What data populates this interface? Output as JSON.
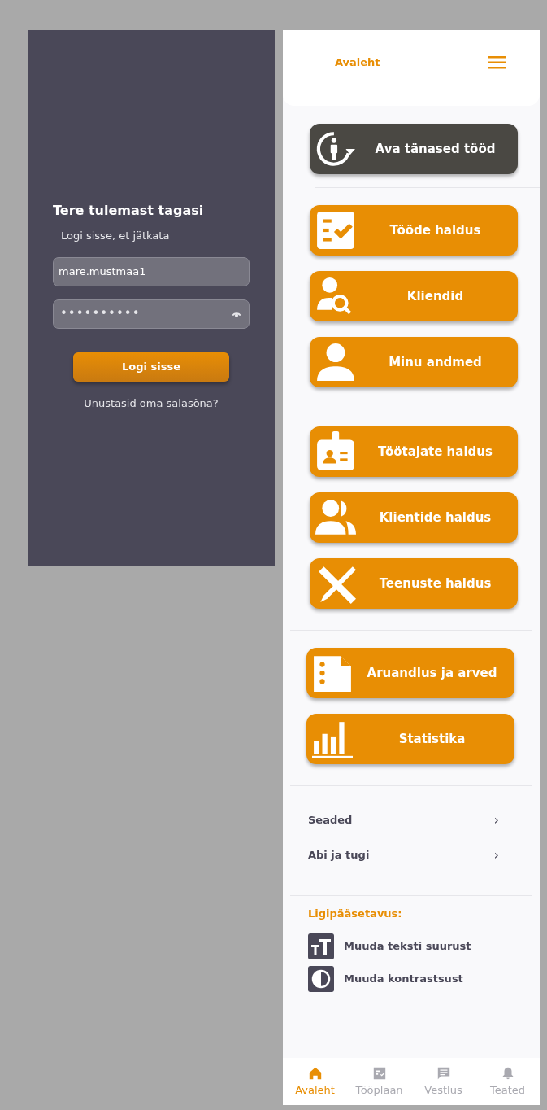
{
  "login": {
    "title": "Tere tulemast tagasi",
    "subtitle": "Logi sisse, et jätkata",
    "username": {
      "value": "mare.mustmaa1"
    },
    "password": {
      "value": "••••••••••"
    },
    "submit": "Logi sisse",
    "forgot": "Unustasid oma salasõna?"
  },
  "header": {
    "title": "Avaleht"
  },
  "menu_groups": [
    {
      "buttons": [
        {
          "label": "Ava tänased tööd",
          "kind": "dark"
        }
      ]
    },
    {
      "buttons": [
        {
          "label": "Tööde haldus",
          "kind": "primary"
        },
        {
          "label": "Kliendid",
          "kind": "primary"
        },
        {
          "label": "Minu andmed",
          "kind": "primary"
        }
      ]
    },
    {
      "buttons": [
        {
          "label": "Töötajate haldus",
          "kind": "primary"
        },
        {
          "label": "Klientide haldus",
          "kind": "primary"
        },
        {
          "label": "Teenuste haldus",
          "kind": "primary"
        }
      ]
    },
    {
      "buttons": [
        {
          "label": "Aruandlus ja arved",
          "kind": "primary"
        },
        {
          "label": "Statistika",
          "kind": "primary"
        }
      ]
    }
  ],
  "links": [
    {
      "label": "Seaded",
      "chevron": "›"
    },
    {
      "label": "Abi ja tugi",
      "chevron": "›"
    }
  ],
  "accessibility": {
    "title": "Ligipääsetavus:",
    "items": [
      {
        "label": "Muuda teksti suurust"
      },
      {
        "label": "Muuda kontrastsust"
      }
    ]
  },
  "bottom_nav": [
    {
      "label": "Avaleht",
      "selected": true
    },
    {
      "label": "Tööplaan",
      "selected": false
    },
    {
      "label": "Vestlus",
      "selected": false
    },
    {
      "label": "Teated",
      "selected": false
    }
  ]
}
